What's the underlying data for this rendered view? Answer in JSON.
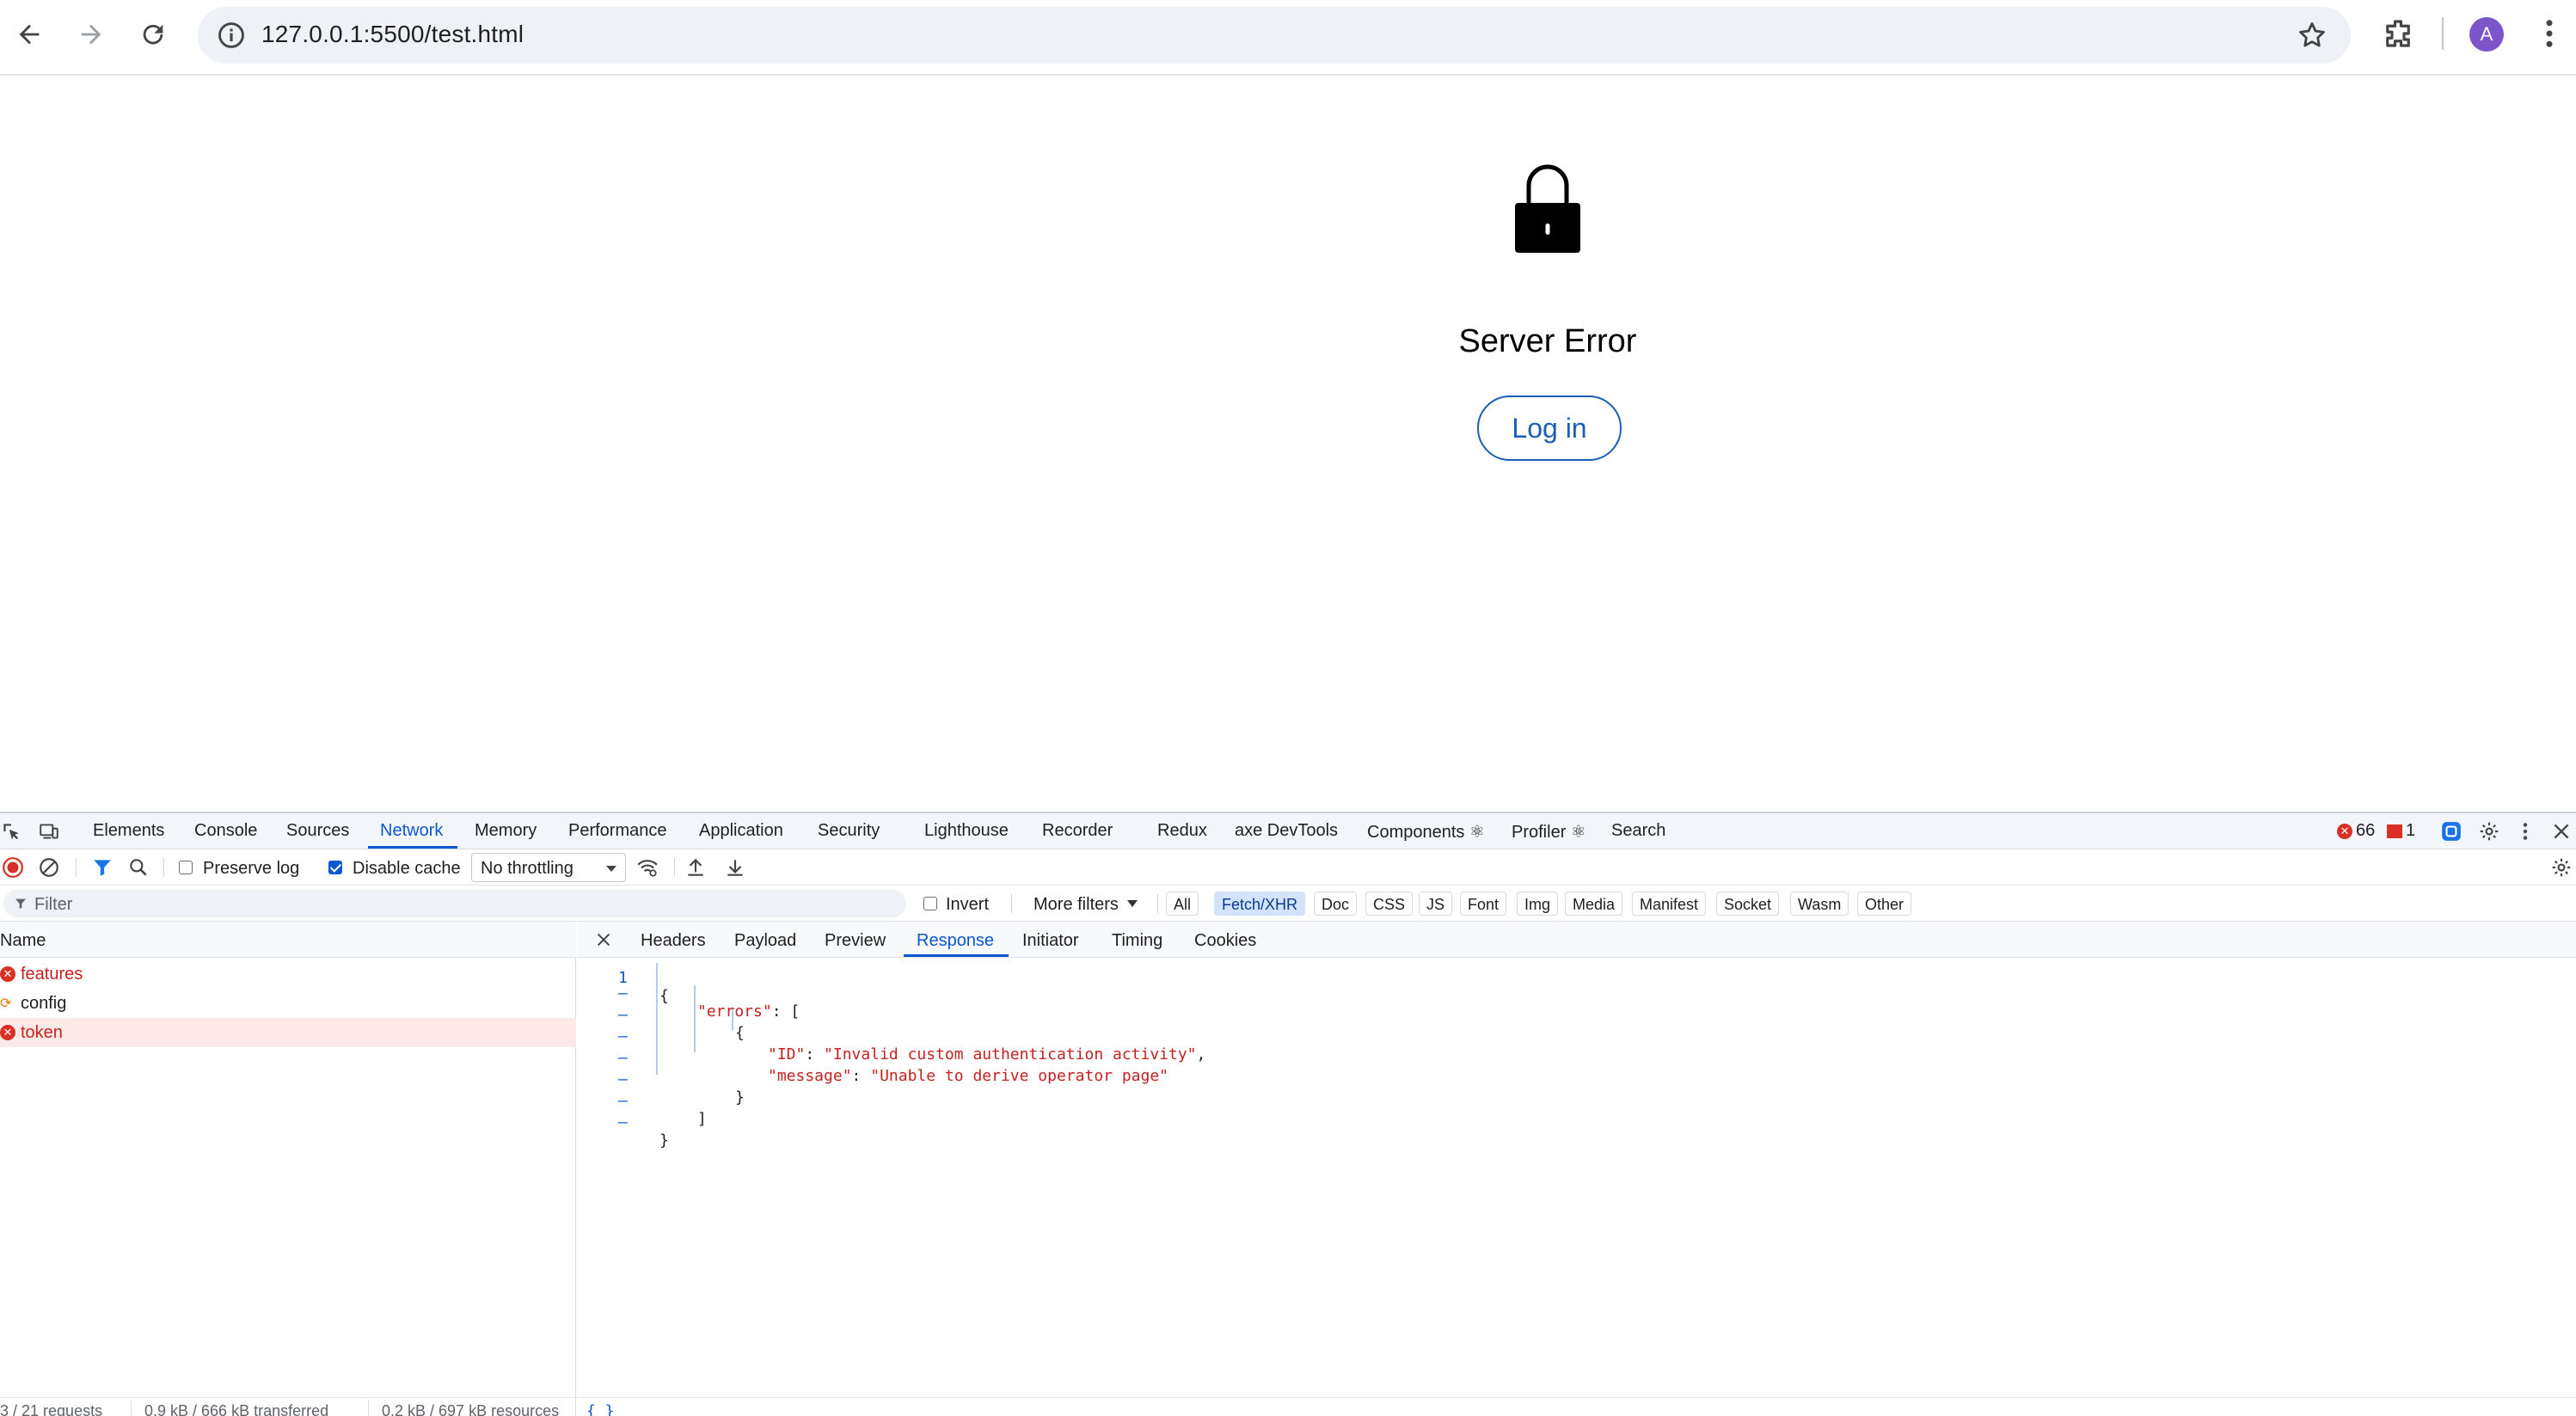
{
  "browser": {
    "url": "127.0.0.1:5500/test.html",
    "profile_initial": "A",
    "icons": [
      "back-arrow-icon",
      "forward-arrow-icon",
      "reload-icon",
      "site-info-icon",
      "bookmark-star-icon",
      "extensions-icon",
      "more-vert-icon"
    ]
  },
  "page": {
    "icon": "lock-icon",
    "title": "Server Error",
    "login_label": "Log in",
    "accent_color": "#1a5fb4"
  },
  "devtools": {
    "tabs": [
      "Elements",
      "Console",
      "Sources",
      "Network",
      "Memory",
      "Performance",
      "Application",
      "Security",
      "Lighthouse",
      "Recorder",
      "Redux",
      "axe DevTools",
      "Components ⚛",
      "Profiler ⚛",
      "Search"
    ],
    "active_tab": "Network",
    "error_count": "66",
    "warning_count": "1",
    "toolbar": {
      "preserve_log": "Preserve log",
      "disable_cache": "Disable cache",
      "throttling": "No throttling"
    },
    "filter": {
      "placeholder": "Filter",
      "invert": "Invert",
      "more_filters": "More filters",
      "types": [
        "All",
        "Fetch/XHR",
        "Doc",
        "CSS",
        "JS",
        "Font",
        "Img",
        "Media",
        "Manifest",
        "Socket",
        "Wasm",
        "Other"
      ],
      "active_type": "Fetch/XHR"
    },
    "requests": {
      "header": "Name",
      "rows": [
        {
          "name": "features",
          "status": "error"
        },
        {
          "name": "config",
          "status": "pending"
        },
        {
          "name": "token",
          "status": "error"
        }
      ]
    },
    "detail_tabs": [
      "Headers",
      "Payload",
      "Preview",
      "Response",
      "Initiator",
      "Timing",
      "Cookies"
    ],
    "active_detail_tab": "Response",
    "response_lines": {
      "l0": "{",
      "l1_key": "\"errors\"",
      "l1_rest": ": [",
      "l2": "{",
      "l3_key": "\"ID\"",
      "l3_sep": ": ",
      "l3_val": "\"Invalid custom authentication activity\"",
      "l3_end": ",",
      "l4_key": "\"message\"",
      "l4_sep": ": ",
      "l4_val": "\"Unable to derive operator page\"",
      "l5": "}",
      "l6": "]",
      "l7": "}",
      "gutter_mark": "–",
      "gutter_first": "1"
    },
    "status": {
      "requests": "3 / 21 requests",
      "transferred": "0.9 kB / 666 kB transferred",
      "resources": "0.2 kB / 697 kB resources",
      "braces": "{ }"
    }
  }
}
